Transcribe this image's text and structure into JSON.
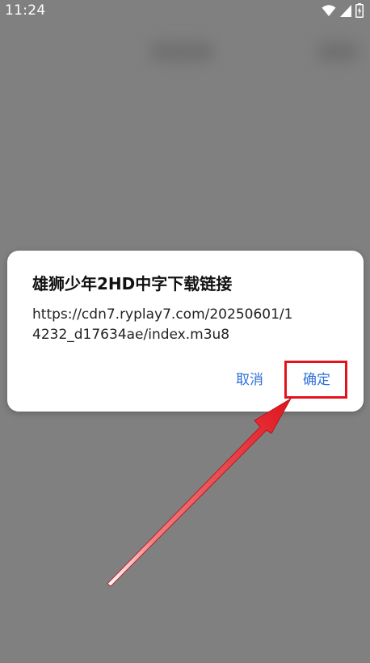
{
  "status_bar": {
    "time": "11:24",
    "icons": [
      "wifi-icon",
      "cellular-signal-icon",
      "battery-icon"
    ]
  },
  "dialog": {
    "title": "雄狮少年2HD中字下载链接",
    "message": "https://cdn7.ryplay7.com/20250601/14232_d17634ae/index.m3u8",
    "cancel_label": "取消",
    "confirm_label": "确定"
  },
  "colors": {
    "scrim": "#808080",
    "button_text": "#2f6fd6",
    "highlight": "#e1141e"
  }
}
